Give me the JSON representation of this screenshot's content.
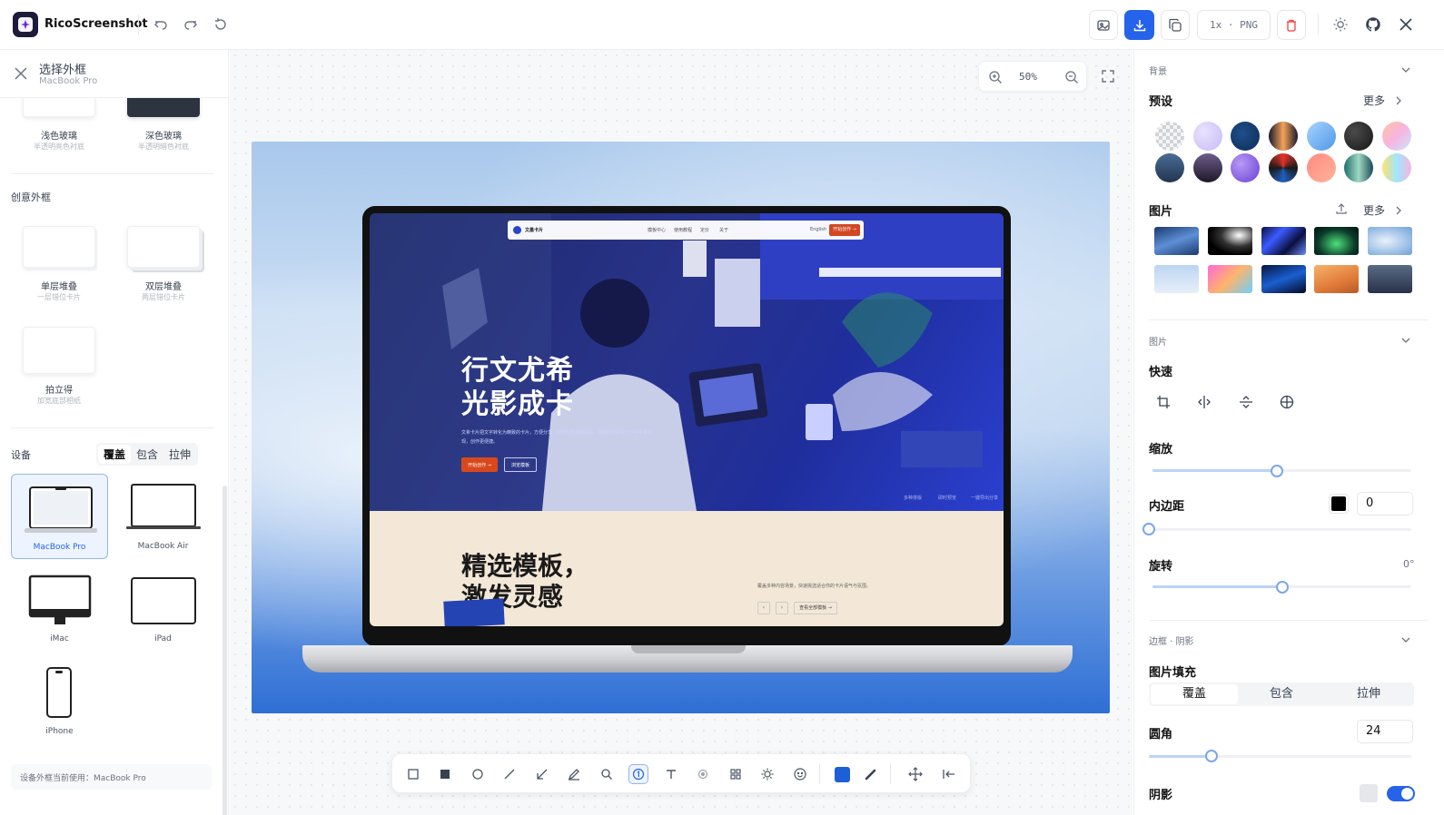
{
  "app": {
    "name": "RicoScreenshot"
  },
  "toolbar": {
    "export_format": "1x · PNG"
  },
  "left_panel": {
    "title": "选择外框",
    "subtitle": "MacBook Pro",
    "glass": [
      {
        "label": "浅色玻璃",
        "sub": "半透明亮色衬底"
      },
      {
        "label": "深色玻璃",
        "sub": "半透明暗色衬底"
      }
    ],
    "creative_title": "创意外框",
    "creative": [
      {
        "label": "单层堆叠",
        "sub": "一层错位卡片"
      },
      {
        "label": "双层堆叠",
        "sub": "两层错位卡片"
      },
      {
        "label": "拍立得",
        "sub": "加宽底部相纸"
      }
    ],
    "device_title": "设备",
    "fit_modes": [
      "覆盖",
      "包含",
      "拉伸"
    ],
    "devices": [
      {
        "label": "MacBook Pro",
        "selected": true
      },
      {
        "label": "MacBook Air",
        "selected": false
      },
      {
        "label": "iMac",
        "selected": false
      },
      {
        "label": "iPad",
        "selected": false
      },
      {
        "label": "iPhone",
        "selected": false
      }
    ],
    "status": "设备外框当前使用：MacBook Pro"
  },
  "canvas": {
    "zoom": "50%",
    "site": {
      "brand": "文墨卡片",
      "nav": [
        "模板中心",
        "使用教程",
        "定价",
        "关于"
      ],
      "lang": "English",
      "cta": "开始创作 →",
      "hero_title_1": "行文尤希",
      "hero_title_2": "光影成卡",
      "hero_desc": "文希卡片把文字转化为精致的卡片，方便分享。即时设置多种排版，复制到剪贴板可获得丰富表现，创作更便捷。",
      "btn_primary": "开始创作 →",
      "btn_secondary": "浏览模板",
      "foot": [
        "多种排版",
        "即时预览",
        "一键导出分享"
      ],
      "lower_title_1": "精选模板，",
      "lower_title_2": "激发灵感",
      "lower_desc": "覆盖多种内容场景，快速挑选适合你的卡片语气与氛围。",
      "lower_btn": "查看全部模板 →"
    }
  },
  "right_panel": {
    "background_section": "背景",
    "presets_label": "预设",
    "more_label": "更多",
    "images_label": "图片",
    "image_section": "图片",
    "quick_label": "快速",
    "scale_label": "缩放",
    "scale_value": 0.48,
    "padding_label": "内边距",
    "padding_value": "0",
    "padding_level": 0,
    "rotate_label": "旋转",
    "rotate_value": "0°",
    "rotate_level": 0.5,
    "border_section": "边框 · 阴影",
    "fill_label": "图片填充",
    "fill_modes": [
      "覆盖",
      "包含",
      "拉伸"
    ],
    "radius_label": "圆角",
    "radius_value": "24",
    "radius_level": 0.24,
    "shadow_label": "阴影",
    "shadow_on": true
  },
  "colors": {
    "accent": "#2563eb",
    "danger": "#ef4444",
    "draw_color": "#1d5fd6"
  }
}
